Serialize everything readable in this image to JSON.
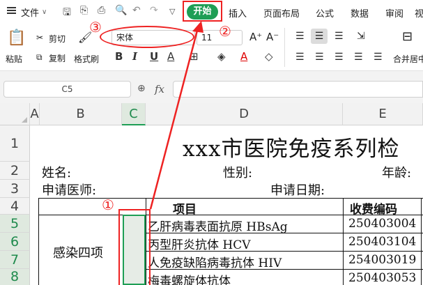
{
  "menu": {
    "file_label": "文件",
    "tabs": [
      "开始",
      "插入",
      "页面布局",
      "公式",
      "数据",
      "审阅",
      "视"
    ]
  },
  "ribbon": {
    "paste": "粘贴",
    "cut": "剪切",
    "copy": "复制",
    "format_painter": "格式刷",
    "font_name": "宋体",
    "font_size": "11",
    "merge_center": "合并居中"
  },
  "formula_bar": {
    "cell_ref": "C5",
    "fx": "fx",
    "value": ""
  },
  "columns": [
    "A",
    "B",
    "C",
    "D",
    "E"
  ],
  "rows": [
    "1",
    "2",
    "3",
    "4",
    "5",
    "6",
    "7",
    "8"
  ],
  "sheet": {
    "title": "xxx市医院免疫系列检",
    "name_label": "姓名:",
    "gender_label": "性别:",
    "age_label": "年龄:",
    "doctor_label": "申请医师:",
    "date_label": "申请日期:",
    "header_item": "项目",
    "header_code": "收费编码",
    "group_label": "感染四项",
    "items": [
      {
        "name": "乙肝病毒表面抗原 HBsAg",
        "code": "250403004"
      },
      {
        "name": "丙型肝炎抗体 HCV",
        "code": "250403104"
      },
      {
        "name": "人免疫缺陷病毒抗体 HIV",
        "code": "254003019"
      },
      {
        "name": "梅毒螺旋体抗体",
        "code": "250403053"
      }
    ]
  },
  "annotations": {
    "one": "①",
    "two": "②",
    "three": "③"
  },
  "colors": {
    "accent": "#1e9e55",
    "annotation": "#e22222"
  }
}
